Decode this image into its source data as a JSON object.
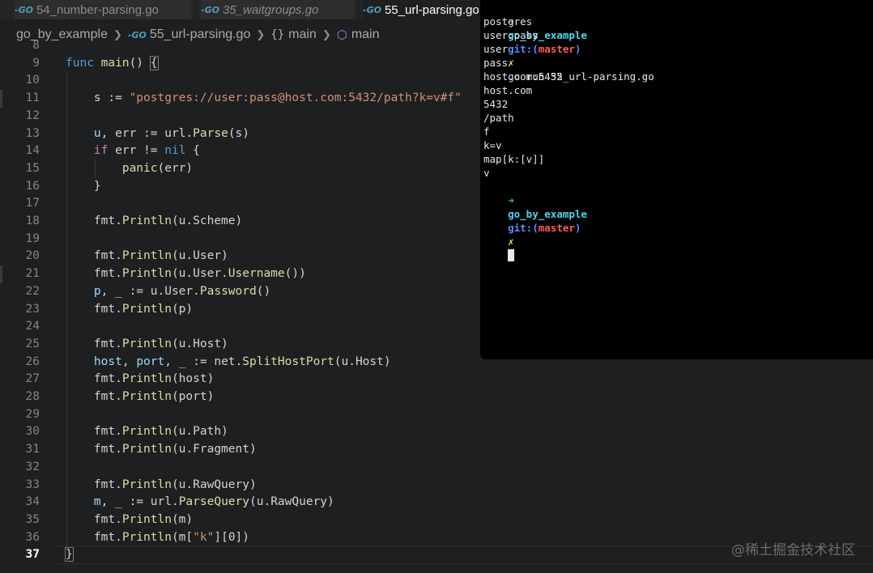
{
  "tabs": [
    {
      "label": "54_number-parsing.go",
      "icon": "go-file-icon"
    },
    {
      "label": "35_waitgroups.go",
      "icon": "go-file-icon"
    },
    {
      "label": "55_url-parsing.go",
      "icon": "go-file-icon"
    }
  ],
  "breadcrumb": {
    "folder": "go_by_example",
    "file": "55_url-parsing.go",
    "symbol1": "main",
    "symbol2": "main"
  },
  "editor": {
    "current_line": "37",
    "lines": [
      {
        "n": "8",
        "code": ""
      },
      {
        "n": "9",
        "code": "func main() {"
      },
      {
        "n": "10",
        "code": ""
      },
      {
        "n": "11",
        "code": "    s := \"postgres://user:pass@host.com:5432/path?k=v#f\""
      },
      {
        "n": "12",
        "code": ""
      },
      {
        "n": "13",
        "code": "    u, err := url.Parse(s)"
      },
      {
        "n": "14",
        "code": "    if err != nil {"
      },
      {
        "n": "15",
        "code": "        panic(err)"
      },
      {
        "n": "16",
        "code": "    }"
      },
      {
        "n": "17",
        "code": ""
      },
      {
        "n": "18",
        "code": "    fmt.Println(u.Scheme)"
      },
      {
        "n": "19",
        "code": ""
      },
      {
        "n": "20",
        "code": "    fmt.Println(u.User)"
      },
      {
        "n": "21",
        "code": "    fmt.Println(u.User.Username())"
      },
      {
        "n": "22",
        "code": "    p, _ := u.User.Password()"
      },
      {
        "n": "23",
        "code": "    fmt.Println(p)"
      },
      {
        "n": "24",
        "code": ""
      },
      {
        "n": "25",
        "code": "    fmt.Println(u.Host)"
      },
      {
        "n": "26",
        "code": "    host, port, _ := net.SplitHostPort(u.Host)"
      },
      {
        "n": "27",
        "code": "    fmt.Println(host)"
      },
      {
        "n": "28",
        "code": "    fmt.Println(port)"
      },
      {
        "n": "29",
        "code": ""
      },
      {
        "n": "30",
        "code": "    fmt.Println(u.Path)"
      },
      {
        "n": "31",
        "code": "    fmt.Println(u.Fragment)"
      },
      {
        "n": "32",
        "code": ""
      },
      {
        "n": "33",
        "code": "    fmt.Println(u.RawQuery)"
      },
      {
        "n": "34",
        "code": "    m, _ := url.ParseQuery(u.RawQuery)"
      },
      {
        "n": "35",
        "code": "    fmt.Println(m)"
      },
      {
        "n": "36",
        "code": "    fmt.Println(m[\"k\"][0])"
      },
      {
        "n": "37",
        "code": "}"
      }
    ]
  },
  "terminal": {
    "prompt_arrow": "➜",
    "prompt_dir": "go_by_example",
    "prompt_git": "git:(",
    "prompt_branch": "master",
    "prompt_git_close": ")",
    "prompt_dirty": "✗",
    "command": "go run 55_url-parsing.go",
    "output": [
      "postgres",
      "user:pass",
      "user",
      "pass",
      "host.com:5432",
      "host.com",
      "5432",
      "/path",
      "f",
      "k=v",
      "map[k:[v]]",
      "v"
    ]
  },
  "watermark": "@稀土掘金技术社区",
  "colors": {
    "editor_bg": "#1e1f20",
    "terminal_bg": "#000000",
    "keyword": "#569cd6",
    "function": "#dcdcaa",
    "string": "#ce9178"
  }
}
